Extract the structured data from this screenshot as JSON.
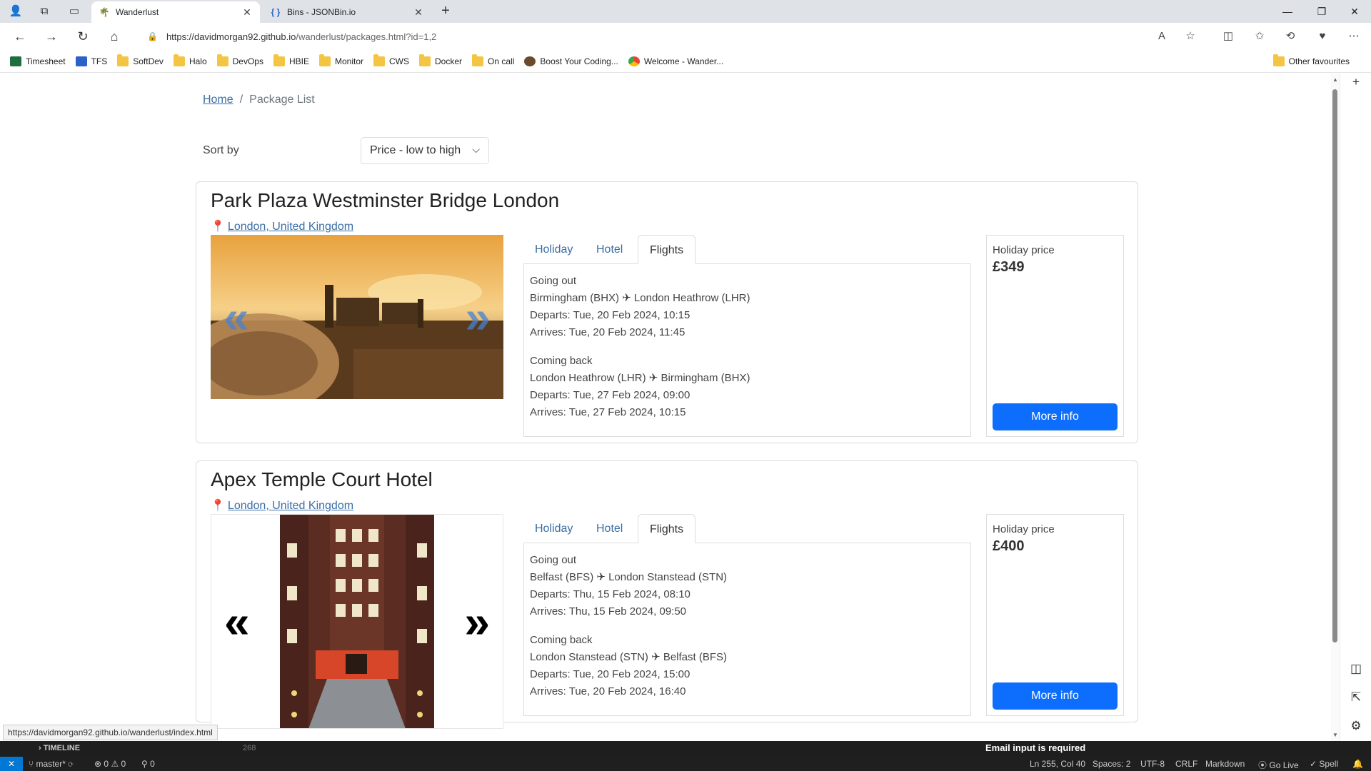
{
  "browser": {
    "tabs": [
      {
        "title": "Wanderlust",
        "active": true
      },
      {
        "title": "Bins - JSONBin.io",
        "active": false
      }
    ],
    "url_host": "https://davidmorgan92.github.io",
    "url_rest": "/wanderlust/packages.html?id=1,2",
    "bookmarks": [
      "Timesheet",
      "TFS",
      "SoftDev",
      "Halo",
      "DevOps",
      "HBIE",
      "Monitor",
      "CWS",
      "Docker",
      "On call",
      "Boost Your Coding...",
      "Welcome - Wander..."
    ],
    "other_favourites": "Other favourites",
    "hover_url": "https://davidmorgan92.github.io/wanderlust/index.html"
  },
  "page": {
    "breadcrumb": {
      "home": "Home",
      "sep": "/",
      "current": "Package List"
    },
    "sort": {
      "label": "Sort by",
      "value": "Price - low to high"
    },
    "packages": [
      {
        "title": "Park Plaza Westminster Bridge London",
        "location": "London, United Kingdom",
        "tabs": [
          "Holiday",
          "Hotel",
          "Flights"
        ],
        "active_tab": "Flights",
        "going_out": {
          "heading": "Going out",
          "route": "Birmingham (BHX) ✈ London Heathrow (LHR)",
          "departs": "Departs: Tue, 20 Feb 2024, 10:15",
          "arrives": "Arrives: Tue, 20 Feb 2024, 11:45"
        },
        "coming_back": {
          "heading": "Coming back",
          "route": "London Heathrow (LHR) ✈ Birmingham (BHX)",
          "departs": "Departs: Tue, 27 Feb 2024, 09:00",
          "arrives": "Arrives: Tue, 27 Feb 2024, 10:15"
        },
        "price_label": "Holiday price",
        "price": "£349",
        "button": "More info"
      },
      {
        "title": "Apex Temple Court Hotel",
        "location": "London, United Kingdom",
        "tabs": [
          "Holiday",
          "Hotel",
          "Flights"
        ],
        "active_tab": "Flights",
        "going_out": {
          "heading": "Going out",
          "route": "Belfast (BFS) ✈ London Stanstead (STN)",
          "departs": "Departs: Thu, 15 Feb 2024, 08:10",
          "arrives": "Arrives: Thu, 15 Feb 2024, 09:50"
        },
        "coming_back": {
          "heading": "Coming back",
          "route": "London Stanstead (STN) ✈ Belfast (BFS)",
          "departs": "Departs: Tue, 20 Feb 2024, 15:00",
          "arrives": "Arrives: Tue, 20 Feb 2024, 16:40"
        },
        "price_label": "Holiday price",
        "price": "£400",
        "button": "More info"
      }
    ]
  },
  "vscode": {
    "timeline": "TIMELINE",
    "line_number": "268",
    "message": "Email input is required",
    "branch": "master*",
    "errors": "0",
    "warnings": "0",
    "ports": "0",
    "position": "Ln 255, Col 40",
    "spaces": "Spaces: 2",
    "encoding": "UTF-8",
    "eol": "CRLF",
    "language": "Markdown",
    "go_live": "Go Live",
    "spell": "Spell"
  },
  "colors": {
    "primary": "#0d6efd",
    "link": "#3a6ea5",
    "vscode_blue": "#0078d4"
  }
}
